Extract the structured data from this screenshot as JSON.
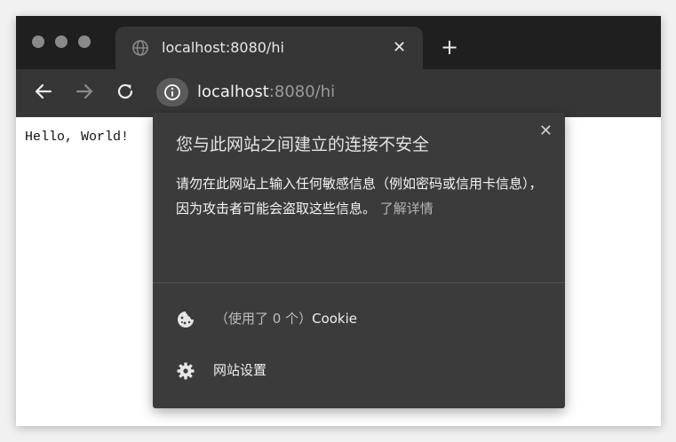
{
  "tab": {
    "title": "localhost:8080/hi",
    "close": "✕",
    "new_tab": "+"
  },
  "toolbar": {
    "url_host": "localhost",
    "url_rest": ":8080/hi"
  },
  "page": {
    "body_text": "Hello, World!"
  },
  "popup": {
    "title": "您与此网站之间建立的连接不安全",
    "description": "请勿在此网站上输入任何敏感信息（例如密码或信用卡信息），因为攻击者可能会盗取这些信息。",
    "learn_more": "了解详情",
    "close": "✕",
    "cookie_muted": "（使用了 0 个）",
    "cookie_label": "Cookie",
    "site_settings": "网站设置"
  },
  "colors": {
    "tabbar_bg": "#1f1f1f",
    "toolbar_bg": "#363636",
    "popup_bg": "#3b3b3b"
  },
  "icons": [
    "globe-icon",
    "back-arrow-icon",
    "forward-arrow-icon",
    "reload-icon",
    "info-icon",
    "cookie-icon",
    "gear-icon"
  ]
}
